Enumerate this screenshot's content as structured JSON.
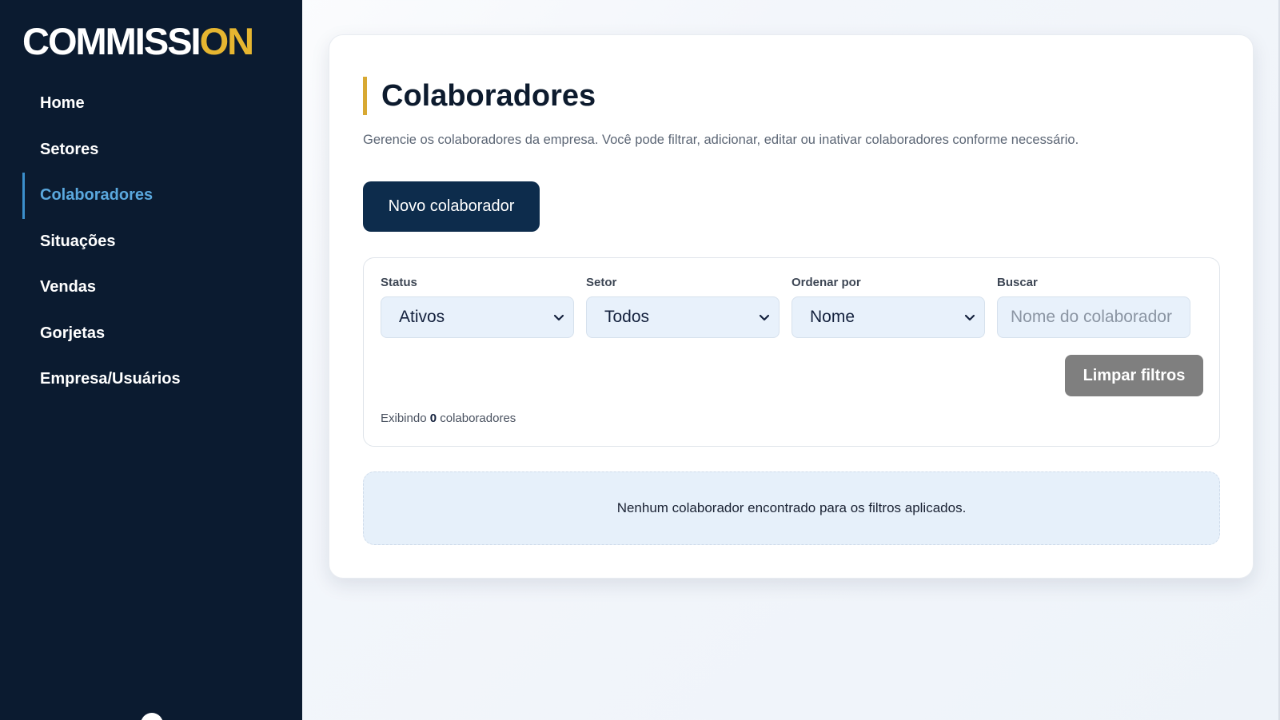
{
  "app": {
    "logo_main": "COMMISS",
    "logo_accent": "ON",
    "logo_i": "I"
  },
  "sidebar": {
    "items": [
      {
        "label": "Home"
      },
      {
        "label": "Setores"
      },
      {
        "label": "Colaboradores",
        "active": true
      },
      {
        "label": "Situações"
      },
      {
        "label": "Vendas"
      },
      {
        "label": "Gorjetas"
      },
      {
        "label": "Empresa/Usuários"
      }
    ]
  },
  "page": {
    "title": "Colaboradores",
    "description": "Gerencie os colaboradores da empresa. Você pode filtrar, adicionar, editar ou inativar colaboradores conforme necessário.",
    "new_button": "Novo colaborador"
  },
  "filters": {
    "status": {
      "label": "Status",
      "value": "Ativos"
    },
    "setor": {
      "label": "Setor",
      "value": "Todos"
    },
    "order": {
      "label": "Ordenar por",
      "value": "Nome"
    },
    "search": {
      "label": "Buscar",
      "placeholder": "Nome do colaborador",
      "value": ""
    },
    "clear_button": "Limpar filtros",
    "count_prefix": "Exibindo",
    "count_value": "0",
    "count_suffix": "colaboradores"
  },
  "empty_state": {
    "message": "Nenhum colaborador encontrado para os filtros aplicados."
  },
  "colors": {
    "sidebar_bg": "#0b1b30",
    "accent_gold": "#e6b630",
    "active_blue": "#5aa8de",
    "primary_button": "#0d2c4c",
    "clear_button": "#7f7f7f"
  }
}
